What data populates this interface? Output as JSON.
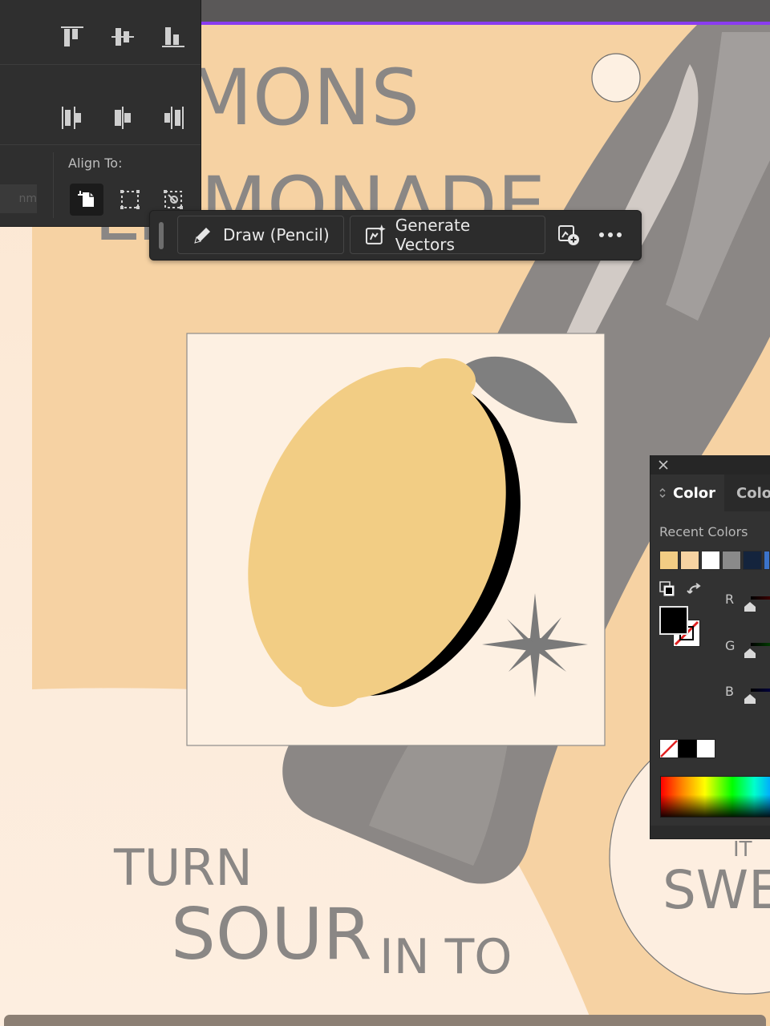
{
  "poster": {
    "line1": "MONS",
    "line2": "MONADE",
    "line2_prefix": "LI",
    "turn": "TURN",
    "sour": "SOUR",
    "into": "IN TO",
    "it": "IT",
    "sweet": "SWE"
  },
  "align_panel": {
    "align_to_label": "Align To:",
    "unit_value": "nm"
  },
  "context_toolbar": {
    "draw_label": "Draw (Pencil)",
    "generate_label": "Generate Vectors"
  },
  "color_panel": {
    "tab_active": "Color",
    "tab_other": "Colo",
    "recent_colors_label": "Recent Colors",
    "recent_colors": [
      "#f2cd84",
      "#f7d3a2",
      "#ffffff",
      "#8a8a8a",
      "#14243d",
      "#3b73c9"
    ],
    "channels": [
      "R",
      "G",
      "B"
    ]
  },
  "colors": {
    "lemon": "#f2cd84",
    "accent": "#8a3cf0",
    "poster_bg": "#f7d3a2",
    "panel_bg": "#2f2f2f"
  }
}
